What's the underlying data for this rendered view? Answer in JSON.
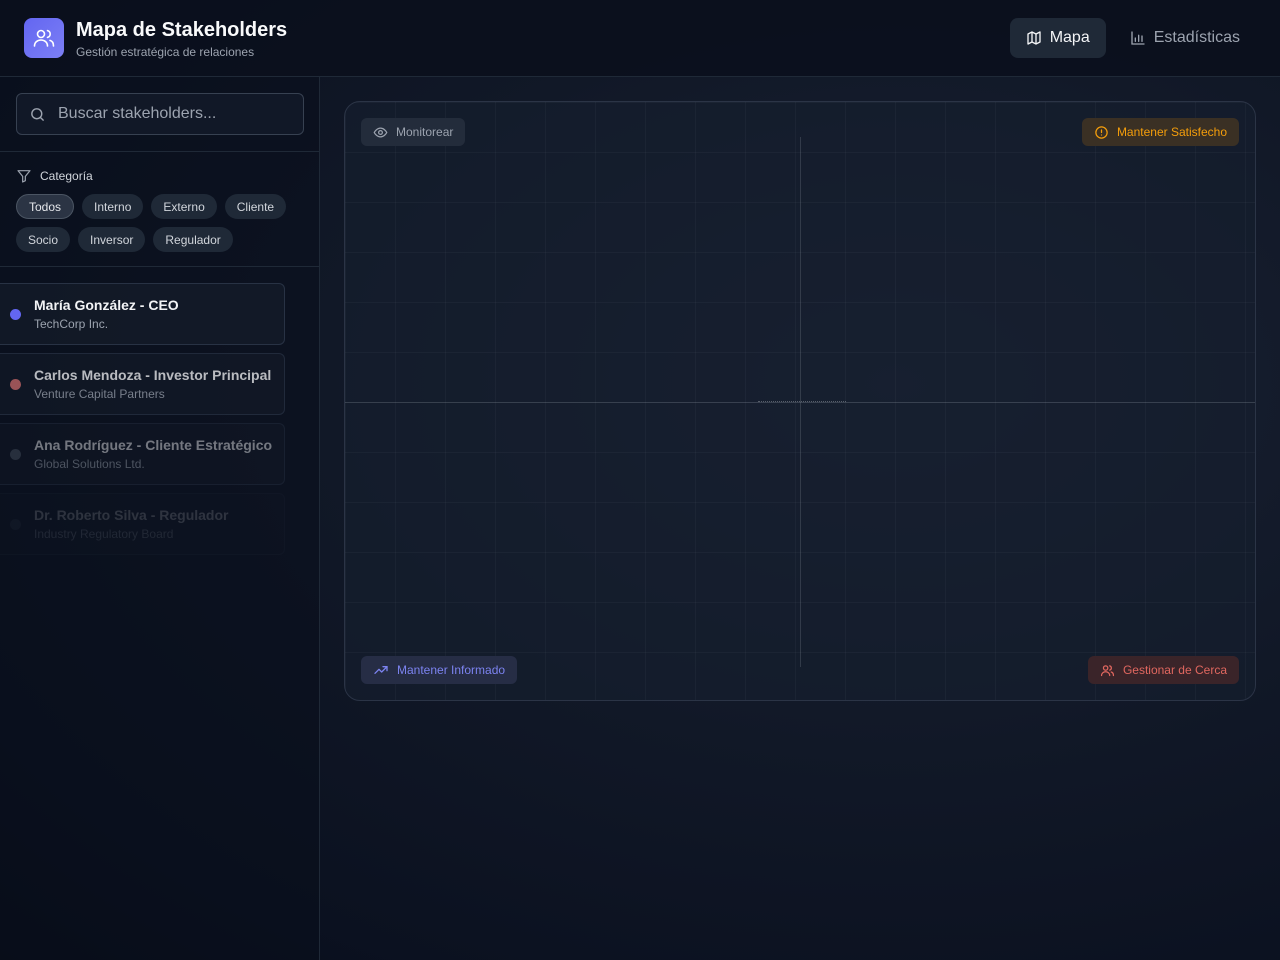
{
  "header": {
    "title": "Mapa de Stakeholders",
    "subtitle": "Gestión estratégica de relaciones",
    "nav": [
      {
        "label": "Mapa",
        "active": true
      },
      {
        "label": "Estadísticas",
        "active": false
      }
    ]
  },
  "sidebar": {
    "search": {
      "placeholder": "Buscar stakeholders...",
      "value": ""
    },
    "filter_label": "Categoría",
    "categories": [
      "Todos",
      "Interno",
      "Externo",
      "Cliente",
      "Socio",
      "Inversor",
      "Regulador"
    ],
    "selected_category": "Todos",
    "stakeholders": [
      {
        "name": "María González - CEO",
        "org": "TechCorp Inc.",
        "color": "#6366f1"
      },
      {
        "name": "Carlos Mendoza - Investor Principal",
        "org": "Venture Capital Partners",
        "color": "#c96a6a"
      },
      {
        "name": "Ana Rodríguez - Cliente Estratégico",
        "org": "Global Solutions Ltd.",
        "color": "#4b5563"
      },
      {
        "name": "Dr. Roberto Silva - Regulador",
        "org": "Industry Regulatory Board",
        "color": "#374151"
      }
    ]
  },
  "map": {
    "quadrants": {
      "top_left": "Monitorear",
      "top_right": "Mantener Satisfecho",
      "bottom_left": "Mantener Informado",
      "bottom_right": "Gestionar de Cerca"
    }
  },
  "colors": {
    "accent": "#6366f1",
    "warning": "#f59e0b",
    "danger": "#e0675f"
  }
}
